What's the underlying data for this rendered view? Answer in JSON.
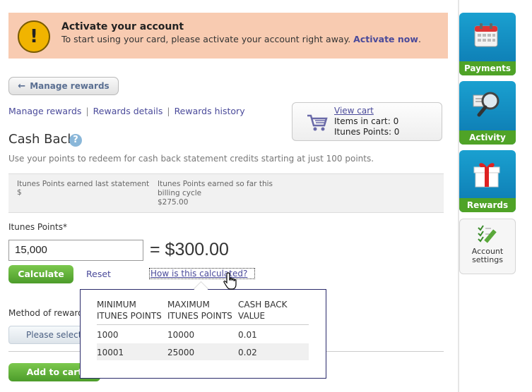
{
  "banner": {
    "title": "Activate your account",
    "text": "To start using your card, please activate your account right away.",
    "link": "Activate now",
    "period": ".",
    "icon": "exclamation-icon",
    "icon_glyph": "!"
  },
  "manage_button": {
    "label": "Manage rewards",
    "icon": "arrow-left-icon"
  },
  "nav": {
    "items": [
      "Manage rewards",
      "Rewards details",
      "Rewards history"
    ],
    "separator": "|"
  },
  "cart": {
    "link": "View cart",
    "items_line": "Items in cart: 0",
    "points_line": "Itunes Points: 0",
    "icon": "shopping-cart-icon"
  },
  "section": {
    "title": "Cash Back",
    "help_glyph": "?",
    "intro": "Use your points to redeem for cash back statement credits starting at just 100 points."
  },
  "info": {
    "last_label": "Itunes Points earned last statement",
    "last_value": "$",
    "current_label": "Itunes Points earned so far this billing cycle",
    "current_value": "$275.00"
  },
  "points": {
    "label": "Itunes Points*",
    "value": "15,000",
    "result": "= $300.00"
  },
  "actions": {
    "calculate": "Calculate",
    "reset": "Reset",
    "how": "How is this calculated?"
  },
  "method": {
    "label": "Method of reward",
    "select": "Please select"
  },
  "add_to_cart": "Add to cart",
  "popup": {
    "headers": [
      [
        "MINIMUM",
        "ITUNES POINTS"
      ],
      [
        "MAXIMUM",
        "ITUNES POINTS"
      ],
      [
        "CASH BACK",
        "VALUE"
      ]
    ],
    "rows": [
      [
        "1000",
        "10000",
        "0.01"
      ],
      [
        "10001",
        "25000",
        "0.02"
      ]
    ]
  },
  "sidebar": {
    "tiles": [
      {
        "label": "Payments",
        "icon": "calendar-icon"
      },
      {
        "label": "Activity",
        "icon": "magnifier-icon"
      },
      {
        "label": "Rewards",
        "icon": "gift-icon"
      },
      {
        "label": "Account settings",
        "icon": "checklist-pencil-icon"
      }
    ]
  },
  "colors": {
    "banner_bg": "#f8cbb1",
    "link": "#4a4a9a",
    "green": "#4fa327",
    "tile_blue": "#0c78b0"
  }
}
